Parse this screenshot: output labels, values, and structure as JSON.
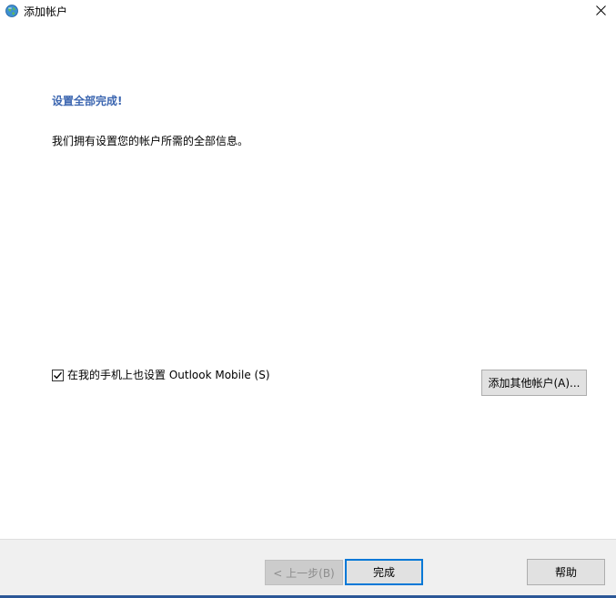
{
  "window": {
    "title": "添加帐户",
    "icon": "outlook-globe-icon"
  },
  "content": {
    "heading": "设置全部完成!",
    "message": "我们拥有设置您的帐户所需的全部信息。",
    "mobile_checkbox": {
      "label": "在我的手机上也设置 Outlook Mobile (S)",
      "checked": true
    },
    "add_another_account_label": "添加其他帐户(A)..."
  },
  "footer": {
    "back_label": "< 上一步(B)",
    "back_disabled": true,
    "finish_label": "完成",
    "help_label": "帮助"
  },
  "colors": {
    "heading": "#3c66b0",
    "footer_bg": "#f0f0f0",
    "accent": "#0078d7",
    "bottom_bar": "#2b5797"
  }
}
